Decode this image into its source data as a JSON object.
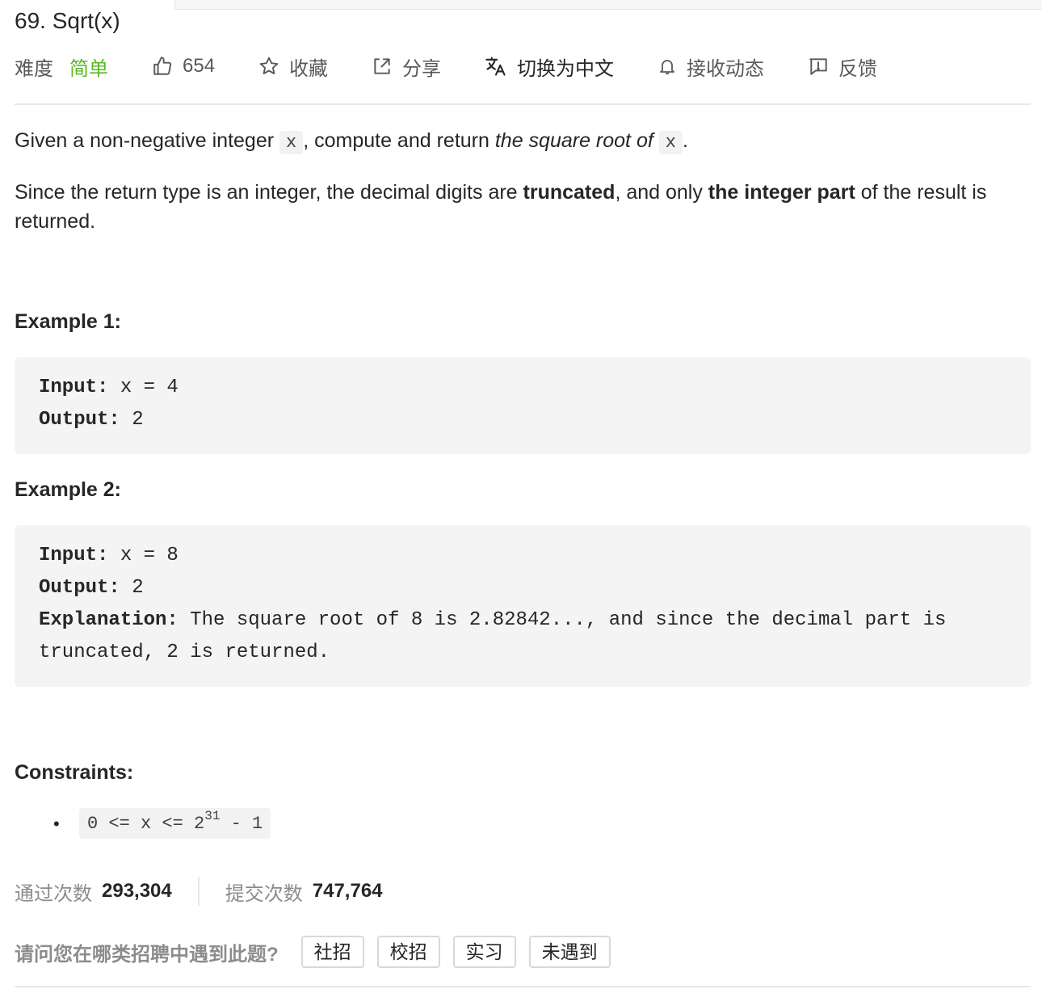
{
  "problem": {
    "title": "69. Sqrt(x)"
  },
  "toolbar": {
    "difficulty_label": "难度",
    "difficulty_value": "简单",
    "likes": "654",
    "favorite_label": "收藏",
    "share_label": "分享",
    "switch_lang_label": "切换为中文",
    "subscribe_label": "接收动态",
    "feedback_label": "反馈",
    "colors": {
      "easy": "#5ab726"
    }
  },
  "description": {
    "p1_a": "Given a non-negative integer ",
    "p1_code1": "x",
    "p1_b": ", compute and return ",
    "p1_em": "the square root of",
    "p1_code2": "x",
    "p1_c": ".",
    "p2_a": "Since the return type is an integer, the decimal digits are ",
    "p2_b1": "truncated",
    "p2_c": ", and only ",
    "p2_b2": "the integer part",
    "p2_d": " of the result is returned."
  },
  "examples": [
    {
      "heading": "Example 1:",
      "input_key": "Input:",
      "input_val": " x = 4",
      "output_key": "Output:",
      "output_val": " 2"
    },
    {
      "heading": "Example 2:",
      "input_key": "Input:",
      "input_val": " x = 8",
      "output_key": "Output:",
      "output_val": " 2",
      "explanation_key": "Explanation:",
      "explanation_val": " The square root of 8 is 2.82842..., and since the decimal part is truncated, 2 is returned."
    }
  ],
  "constraints": {
    "heading": "Constraints:",
    "item_a": "0 <= x <= 2",
    "item_sup": "31",
    "item_b": " - 1"
  },
  "stats": {
    "accepted_label": "通过次数",
    "accepted_value": "293,304",
    "submissions_label": "提交次数",
    "submissions_value": "747,764"
  },
  "survey": {
    "question": "请问您在哪类招聘中遇到此题?",
    "options": [
      "社招",
      "校招",
      "实习",
      "未遇到"
    ]
  }
}
